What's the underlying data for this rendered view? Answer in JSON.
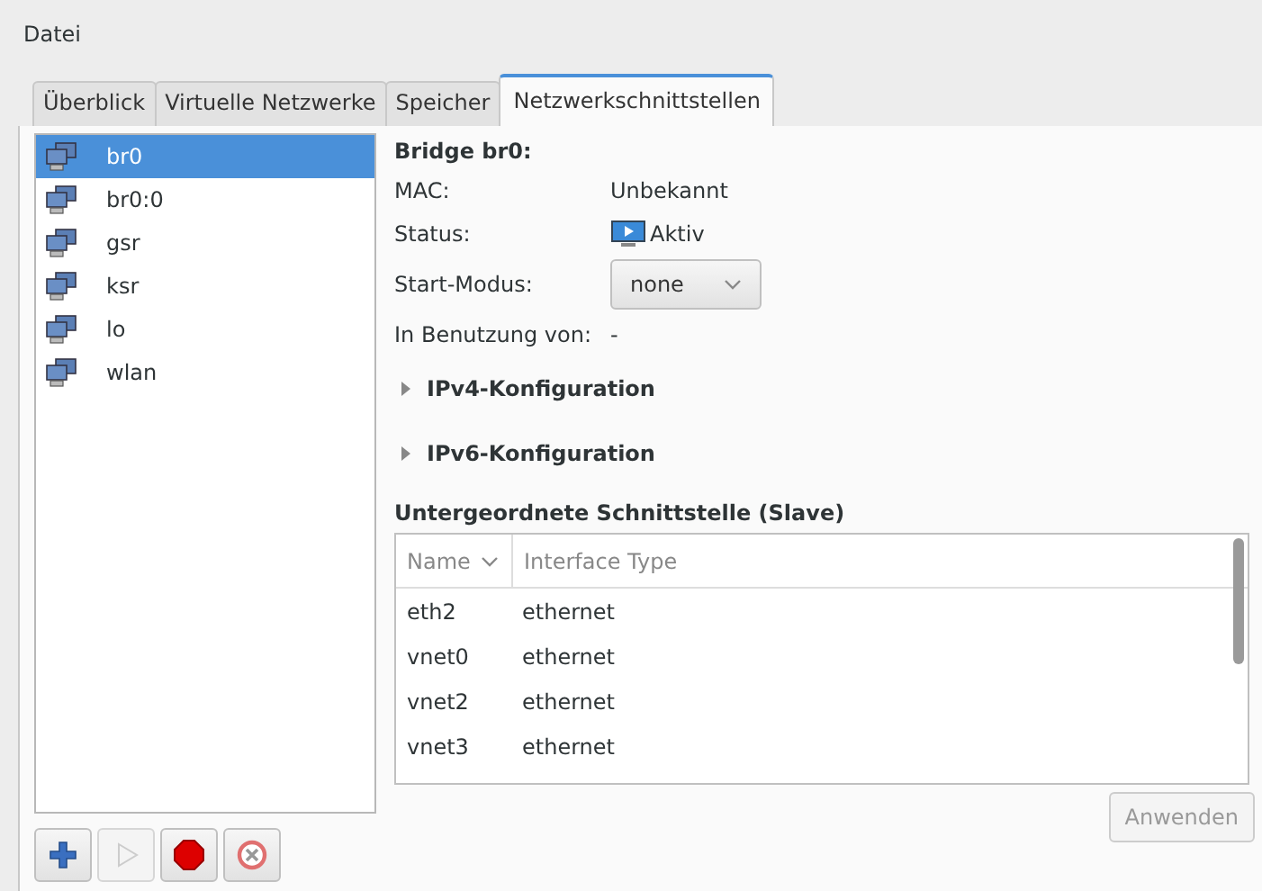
{
  "menu": [
    "Datei"
  ],
  "tabs": [
    {
      "label": "Überblick",
      "selected": false
    },
    {
      "label": "Virtuelle Netzwerke",
      "selected": false
    },
    {
      "label": "Speicher",
      "selected": false
    },
    {
      "label": "Netzwerkschnittstellen",
      "selected": true
    }
  ],
  "interfaces": [
    {
      "name": "br0",
      "selected": true
    },
    {
      "name": "br0:0",
      "selected": false
    },
    {
      "name": "gsr",
      "selected": false
    },
    {
      "name": "ksr",
      "selected": false
    },
    {
      "name": "lo",
      "selected": false
    },
    {
      "name": "wlan",
      "selected": false
    }
  ],
  "toolbar": [
    {
      "kind": "add",
      "disabled": false
    },
    {
      "kind": "start",
      "disabled": true
    },
    {
      "kind": "stop",
      "disabled": false
    },
    {
      "kind": "delete",
      "disabled": false
    }
  ],
  "details": {
    "title": "Bridge br0:",
    "fields": [
      {
        "kind": "text",
        "label": "MAC:",
        "value": "Unbekannt"
      },
      {
        "kind": "status",
        "label": "Status:",
        "value": "Aktiv"
      },
      {
        "kind": "select",
        "label": "Start-Modus:",
        "value": "none"
      },
      {
        "kind": "text",
        "label": "In Benutzung von:",
        "value": "-"
      }
    ],
    "sections": [
      {
        "label": "IPv4-Konfiguration",
        "expanded": false
      },
      {
        "label": "IPv6-Konfiguration",
        "expanded": false
      }
    ],
    "slave_title": "Untergeordnete Schnittstelle (Slave)",
    "columns": [
      "Name",
      "Interface Type"
    ],
    "rows": [
      [
        "eth2",
        "ethernet"
      ],
      [
        "vnet0",
        "ethernet"
      ],
      [
        "vnet2",
        "ethernet"
      ],
      [
        "vnet3",
        "ethernet"
      ]
    ]
  },
  "apply_button": {
    "label": "Anwenden",
    "disabled": true
  }
}
